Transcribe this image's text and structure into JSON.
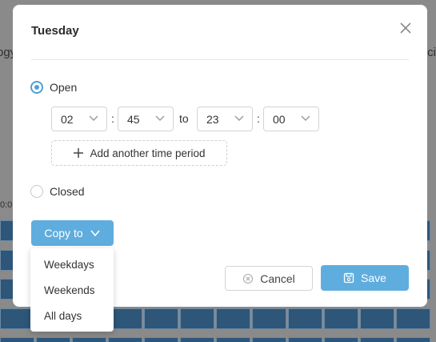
{
  "background": {
    "left_text": "ogy",
    "right_text": "ci",
    "time_label": "0:0"
  },
  "modal": {
    "title": "Tuesday",
    "open_label": "Open",
    "closed_label": "Closed",
    "status": "open",
    "time_from": {
      "hour": "02",
      "minute": "45"
    },
    "time_to": {
      "hour": "23",
      "minute": "00"
    },
    "to_label": "to",
    "colon": ":",
    "add_period_label": "Add another time period",
    "copy_to_label": "Copy to",
    "cancel_label": "Cancel",
    "save_label": "Save"
  },
  "copy_menu": {
    "items": [
      "Weekdays",
      "Weekends",
      "All days"
    ]
  },
  "colors": {
    "accent": "#5fadde",
    "radio_checked": "#4f9fd9",
    "grid_cell": "#2d5679"
  }
}
